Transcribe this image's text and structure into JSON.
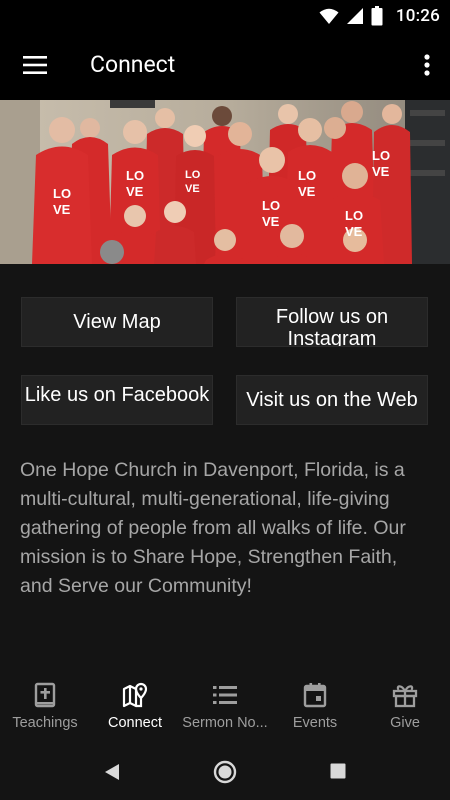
{
  "status": {
    "time": "10:26"
  },
  "app_bar": {
    "title": "Connect"
  },
  "buttons": [
    {
      "label": "View Map"
    },
    {
      "label": "Follow us on Instagram"
    },
    {
      "label": "Like us on Facebook"
    },
    {
      "label": "Visit us on the Web"
    }
  ],
  "description": "One Hope Church in Davenport, Florida, is a multi-cultural, multi-generational, life-giving gathering of people from all walks of life.  Our mission is to Share Hope, Strengthen Faith, and Serve our Community!",
  "bottom_nav": {
    "items": [
      {
        "label": "Teachings",
        "icon": "bible-icon",
        "active": false
      },
      {
        "label": "Connect",
        "icon": "map-pin-icon",
        "active": true
      },
      {
        "label": "Sermon No...",
        "icon": "list-icon",
        "active": false
      },
      {
        "label": "Events",
        "icon": "calendar-icon",
        "active": false
      },
      {
        "label": "Give",
        "icon": "gift-icon",
        "active": false
      }
    ]
  },
  "colors": {
    "background": "#141414",
    "bar": "#000000",
    "button": "#222222",
    "text_muted": "#a6a6a6",
    "shirt_red": "#d42a2a"
  }
}
